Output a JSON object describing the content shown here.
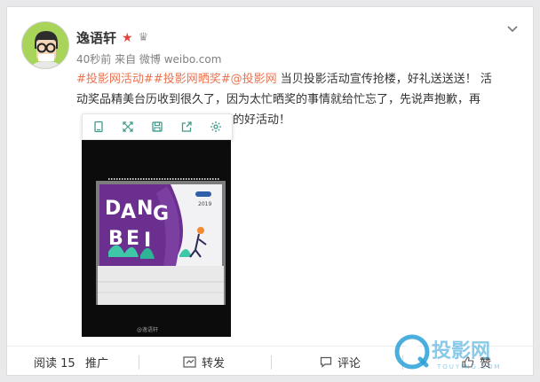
{
  "post": {
    "username": "逸语轩",
    "meta": "40秒前 来自 微博 weibo.com",
    "tags": [
      "#投影网活动#",
      "#投影网晒奖#",
      "@投影网"
    ],
    "text_line1_rest": " 当贝投影活动宣传抢楼，好礼送送送！ 活",
    "text_line2": "动奖品精美台历收到很久了，因为太忙晒奖的事情就给忙忘了，先说声抱歉，再",
    "text_line3_visible": "的好活动！"
  },
  "image": {
    "calendar_brand": "DANGBEI",
    "calendar_letters": [
      "D",
      "A",
      "N",
      "G",
      "B",
      "E",
      "I"
    ],
    "calendar_year": "2019",
    "watermark": "@逸语轩"
  },
  "toolbar": {
    "icons": [
      "view-original-icon",
      "expand-icon",
      "save-icon",
      "share-icon",
      "settings-icon"
    ]
  },
  "actions": {
    "read_label": "阅读 15",
    "promote_label": "推广",
    "repost_label": "转发",
    "comment_label": "评论",
    "like_label": "赞"
  },
  "brand_overlay": {
    "cn": "投影网",
    "en": "TOUYING.COM"
  },
  "colors": {
    "tag": "#eb7350",
    "calendar_purple": "#6b2f8f",
    "logo_blue": "#2aa0d8"
  }
}
